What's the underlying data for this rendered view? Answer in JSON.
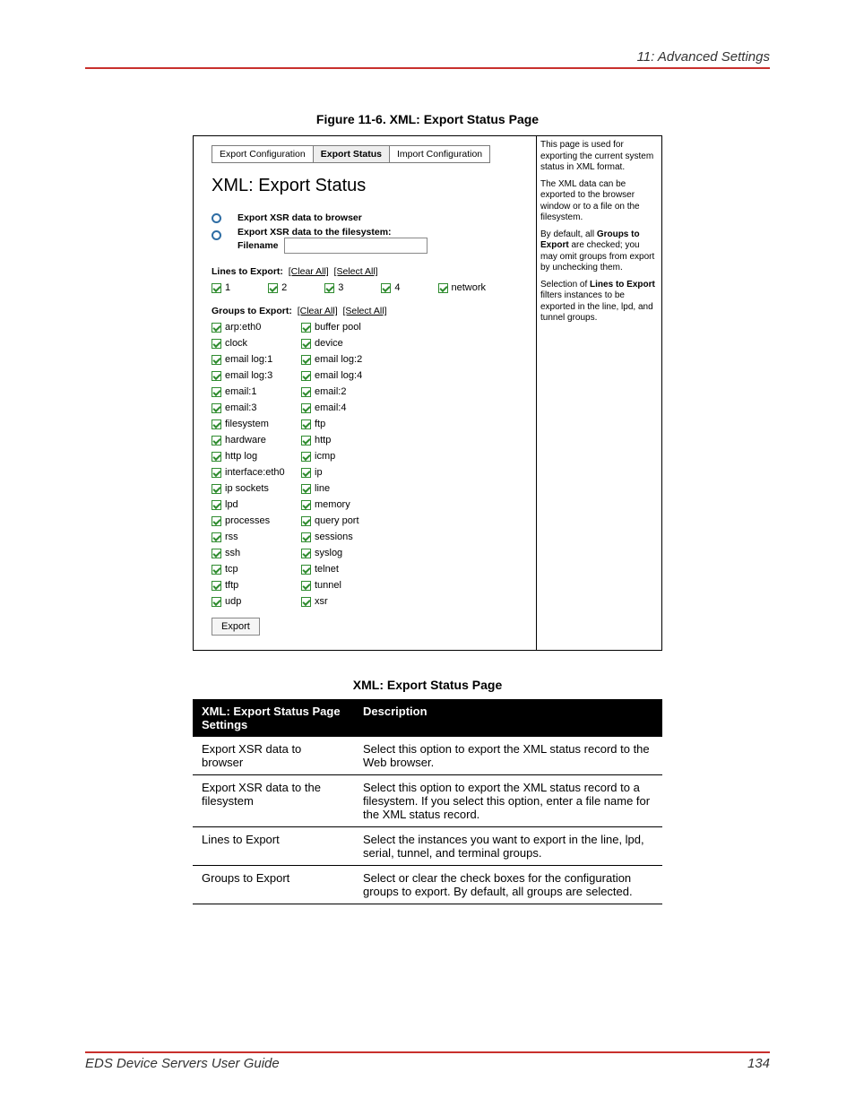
{
  "header": {
    "section": "11: Advanced Settings"
  },
  "figure_caption": "Figure 11-6. XML: Export Status Page",
  "ui": {
    "tabs": [
      "Export Configuration",
      "Export Status",
      "Import Configuration"
    ],
    "heading": "XML: Export Status",
    "radio_browser": "Export XSR data to browser",
    "radio_fs_label": "Export XSR data to the filesystem:",
    "filename_label": "Filename",
    "lines_label": "Lines to Export:",
    "clear_all": "[Clear All]",
    "select_all": "[Select All]",
    "lines": [
      "1",
      "2",
      "3",
      "4",
      "network"
    ],
    "groups_label": "Groups to Export:",
    "groups": [
      "arp:eth0",
      "buffer pool",
      "clock",
      "device",
      "email log:1",
      "email log:2",
      "email log:3",
      "email log:4",
      "email:1",
      "email:2",
      "email:3",
      "email:4",
      "filesystem",
      "ftp",
      "hardware",
      "http",
      "http log",
      "icmp",
      "interface:eth0",
      "ip",
      "ip sockets",
      "line",
      "lpd",
      "memory",
      "processes",
      "query port",
      "rss",
      "sessions",
      "ssh",
      "syslog",
      "tcp",
      "telnet",
      "tftp",
      "tunnel",
      "udp",
      "xsr"
    ],
    "export_btn": "Export",
    "help": {
      "p1": "This page is used for exporting the current system status in XML format.",
      "p2": "The XML data can be exported to the browser window or to a file on the filesystem.",
      "p3a": "By default, all ",
      "p3b": "Groups to Export",
      "p3c": " are checked; you may omit groups from export by unchecking them.",
      "p4a": "Selection of ",
      "p4b": "Lines to Export",
      "p4c": " filters instances to be exported in the line, lpd, and tunnel groups."
    }
  },
  "table_caption": "XML: Export Status Page",
  "table": {
    "h1": "XML: Export Status Page Settings",
    "h2": "Description",
    "rows": [
      {
        "s": "Export XSR data to browser",
        "d": "Select this option to export the XML status record to the Web browser."
      },
      {
        "s": "Export XSR data to the filesystem",
        "d": "Select this option to export the XML status record to a filesystem. If you select this option, enter a file name for the XML status record."
      },
      {
        "s": "Lines to Export",
        "d": "Select the instances you want to export in the line, lpd, serial, tunnel, and terminal groups."
      },
      {
        "s": "Groups to Export",
        "d": "Select or clear the check boxes for the configuration groups to export. By default, all groups are selected."
      }
    ]
  },
  "footer": {
    "left": "EDS Device Servers User Guide",
    "right": "134"
  }
}
